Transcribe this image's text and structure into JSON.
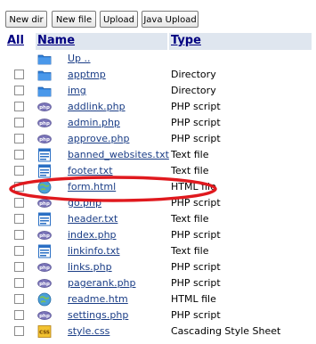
{
  "toolbar": {
    "new_dir": "New dir",
    "new_file": "New file",
    "upload": "Upload",
    "java_upload": "Java Upload"
  },
  "table": {
    "headers": {
      "all": "All",
      "name": "Name",
      "type": "Type"
    },
    "rows": [
      {
        "name": "Up ..",
        "type": "",
        "icon": "folder-icon",
        "checkbox": false
      },
      {
        "name": "apptmp",
        "type": "Directory",
        "icon": "folder-icon",
        "checkbox": true
      },
      {
        "name": "img",
        "type": "Directory",
        "icon": "folder-icon",
        "checkbox": true
      },
      {
        "name": "addlink.php",
        "type": "PHP script",
        "icon": "php-icon",
        "checkbox": true
      },
      {
        "name": "admin.php",
        "type": "PHP script",
        "icon": "php-icon",
        "checkbox": true
      },
      {
        "name": "approve.php",
        "type": "PHP script",
        "icon": "php-icon",
        "checkbox": true
      },
      {
        "name": "banned_websites.txt",
        "type": "Text file",
        "icon": "text-file-icon",
        "checkbox": true
      },
      {
        "name": "footer.txt",
        "type": "Text file",
        "icon": "text-file-icon",
        "checkbox": true
      },
      {
        "name": "form.html",
        "type": "HTML file",
        "icon": "html-file-icon",
        "checkbox": true
      },
      {
        "name": "go.php",
        "type": "PHP script",
        "icon": "php-icon",
        "checkbox": true
      },
      {
        "name": "header.txt",
        "type": "Text file",
        "icon": "text-file-icon",
        "checkbox": true
      },
      {
        "name": "index.php",
        "type": "PHP script",
        "icon": "php-icon",
        "checkbox": true
      },
      {
        "name": "linkinfo.txt",
        "type": "Text file",
        "icon": "text-file-icon",
        "checkbox": true
      },
      {
        "name": "links.php",
        "type": "PHP script",
        "icon": "php-icon",
        "checkbox": true
      },
      {
        "name": "pagerank.php",
        "type": "PHP script",
        "icon": "php-icon",
        "checkbox": true
      },
      {
        "name": "readme.htm",
        "type": "HTML file",
        "icon": "html-file-icon",
        "checkbox": true
      },
      {
        "name": "settings.php",
        "type": "PHP script",
        "icon": "php-icon",
        "checkbox": true
      },
      {
        "name": "style.css",
        "type": "Cascading Style Sheet",
        "icon": "css-file-icon",
        "checkbox": true
      }
    ]
  },
  "colors": {
    "header_bg": "#dfe6ef",
    "header_text": "#000080",
    "link": "#1a3d86",
    "annotation": "#e0191e"
  }
}
